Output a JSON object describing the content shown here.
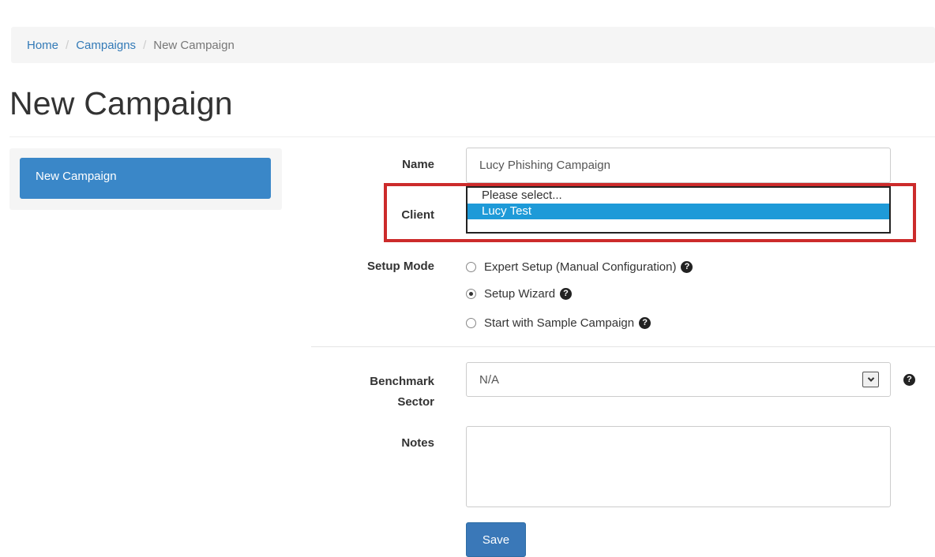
{
  "breadcrumb": {
    "items": [
      "Home",
      "Campaigns"
    ],
    "separator": "/",
    "current": "New Campaign"
  },
  "page": {
    "title": "New Campaign"
  },
  "sidebar": {
    "items": [
      {
        "label": "New Campaign",
        "active": true
      }
    ]
  },
  "form": {
    "name": {
      "label": "Name",
      "value": "Lucy Phishing Campaign"
    },
    "client": {
      "label": "Client",
      "options": [
        "Please select...",
        "Lucy Test"
      ],
      "selected": "Lucy Test"
    },
    "setup_mode": {
      "label": "Setup Mode",
      "options": [
        {
          "label": "Expert Setup (Manual Configuration)",
          "checked": false
        },
        {
          "label": "Setup Wizard",
          "checked": true
        },
        {
          "label": "Start with Sample Campaign",
          "checked": false
        }
      ]
    },
    "benchmark_sector": {
      "label_line1": "Benchmark",
      "label_line2": "Sector",
      "value": "N/A"
    },
    "notes": {
      "label": "Notes",
      "value": ""
    },
    "save_label": "Save"
  },
  "icons": {
    "help": "question-circle-icon",
    "help_glyph": "?"
  },
  "colors": {
    "primary": "#3a87c8",
    "highlight": "#cc2b2b",
    "selected_option": "#1e9ad8"
  }
}
